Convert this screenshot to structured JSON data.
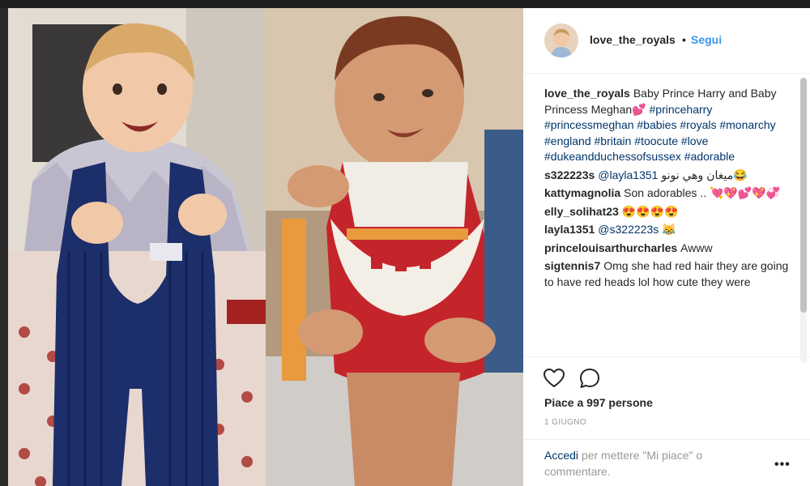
{
  "post": {
    "username": "love_the_royals",
    "separator": "•",
    "follow_label": "Segui",
    "likes_text": "Piace a 997 persone",
    "date": "1 GIUGNO",
    "login_link": "Accedi",
    "login_rest": " per mettere \"Mi piace\" o commentare.",
    "more_label": "•••"
  },
  "caption": {
    "user": "love_the_royals",
    "text": "Baby Prince Harry and Baby Princess Meghan💕 ",
    "hashtags": "#princeharry #princessmeghan #babies #royals #monarchy #england #britain #toocute #love #dukeandduchessofsussex #adorable"
  },
  "comments": [
    {
      "user": "s322223s",
      "mention": "@layla1351",
      "text": " ميغان وهي نونو😂"
    },
    {
      "user": "kattymagnolia",
      "mention": "",
      "text": "Son adorables .. 💘💖💕💖💞"
    },
    {
      "user": "elly_solihat23",
      "mention": "",
      "text": "😍😍😍😍"
    },
    {
      "user": "layla1351",
      "mention": "@s322223s",
      "text": " 😹"
    },
    {
      "user": "princelouisarthurcharles",
      "mention": "",
      "text": "Awww"
    },
    {
      "user": "sigtennis7",
      "mention": "",
      "text": "Omg she had red hair they are going to have red heads lol how cute they were"
    }
  ],
  "icons": {
    "like": "heart-icon",
    "comment": "comment-icon",
    "more": "more-options-icon"
  },
  "colors": {
    "link": "#3897f0",
    "hashtag": "#003569",
    "text": "#262626",
    "muted": "#999999"
  }
}
